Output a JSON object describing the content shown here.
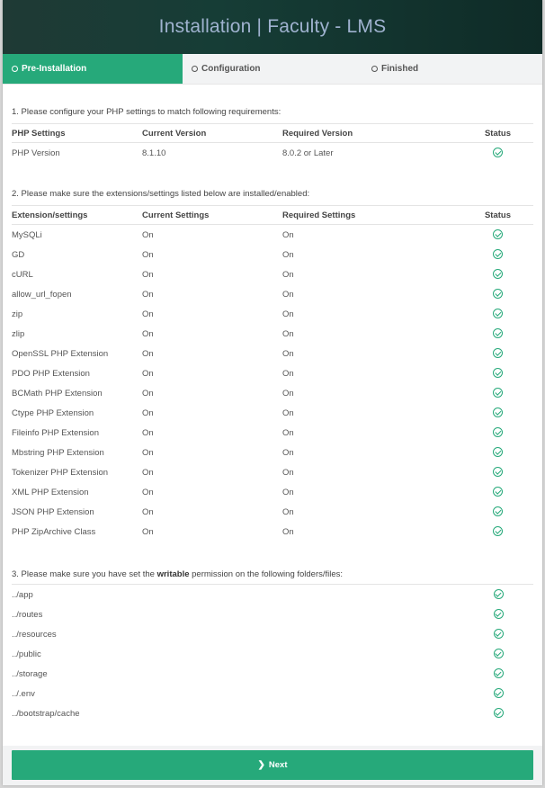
{
  "header": {
    "title": "Installation | Faculty - LMS"
  },
  "steps": [
    {
      "label": "Pre-Installation",
      "active": true
    },
    {
      "label": "Configuration",
      "active": false
    },
    {
      "label": "Finished",
      "active": false
    }
  ],
  "php": {
    "title": "1. Please configure your PHP settings to match following requirements:",
    "headers": [
      "PHP Settings",
      "Current Version",
      "Required Version",
      "Status"
    ],
    "rows": [
      {
        "name": "PHP Version",
        "current": "8.1.10",
        "required": "8.0.2 or Later",
        "status": "ok"
      }
    ]
  },
  "extensions": {
    "title": "2. Please make sure the extensions/settings listed below are installed/enabled:",
    "headers": [
      "Extension/settings",
      "Current Settings",
      "Required Settings",
      "Status"
    ],
    "rows": [
      {
        "name": "MySQLi",
        "current": "On",
        "required": "On"
      },
      {
        "name": "GD",
        "current": "On",
        "required": "On"
      },
      {
        "name": "cURL",
        "current": "On",
        "required": "On"
      },
      {
        "name": "allow_url_fopen",
        "current": "On",
        "required": "On"
      },
      {
        "name": "zip",
        "current": "On",
        "required": "On"
      },
      {
        "name": "zlip",
        "current": "On",
        "required": "On"
      },
      {
        "name": "OpenSSL PHP Extension",
        "current": "On",
        "required": "On"
      },
      {
        "name": "PDO PHP Extension",
        "current": "On",
        "required": "On"
      },
      {
        "name": "BCMath PHP Extension",
        "current": "On",
        "required": "On"
      },
      {
        "name": "Ctype PHP Extension",
        "current": "On",
        "required": "On"
      },
      {
        "name": "Fileinfo PHP Extension",
        "current": "On",
        "required": "On"
      },
      {
        "name": "Mbstring PHP Extension",
        "current": "On",
        "required": "On"
      },
      {
        "name": "Tokenizer PHP Extension",
        "current": "On",
        "required": "On"
      },
      {
        "name": "XML PHP Extension",
        "current": "On",
        "required": "On"
      },
      {
        "name": "JSON PHP Extension",
        "current": "On",
        "required": "On"
      },
      {
        "name": "PHP ZipArchive Class",
        "current": "On",
        "required": "On"
      }
    ]
  },
  "permissions": {
    "title_prefix": "3. Please make sure you have set the ",
    "title_bold": "writable",
    "title_suffix": " permission on the following folders/files:",
    "rows": [
      {
        "path": "../app"
      },
      {
        "path": "../routes"
      },
      {
        "path": "../resources"
      },
      {
        "path": "../public"
      },
      {
        "path": "../storage"
      },
      {
        "path": "../.env"
      },
      {
        "path": "../bootstrap/cache"
      }
    ]
  },
  "footer": {
    "next_label": "Next"
  },
  "colors": {
    "accent": "#26a97a",
    "header_bg": "#163d36",
    "header_text": "#9fb2cf"
  }
}
